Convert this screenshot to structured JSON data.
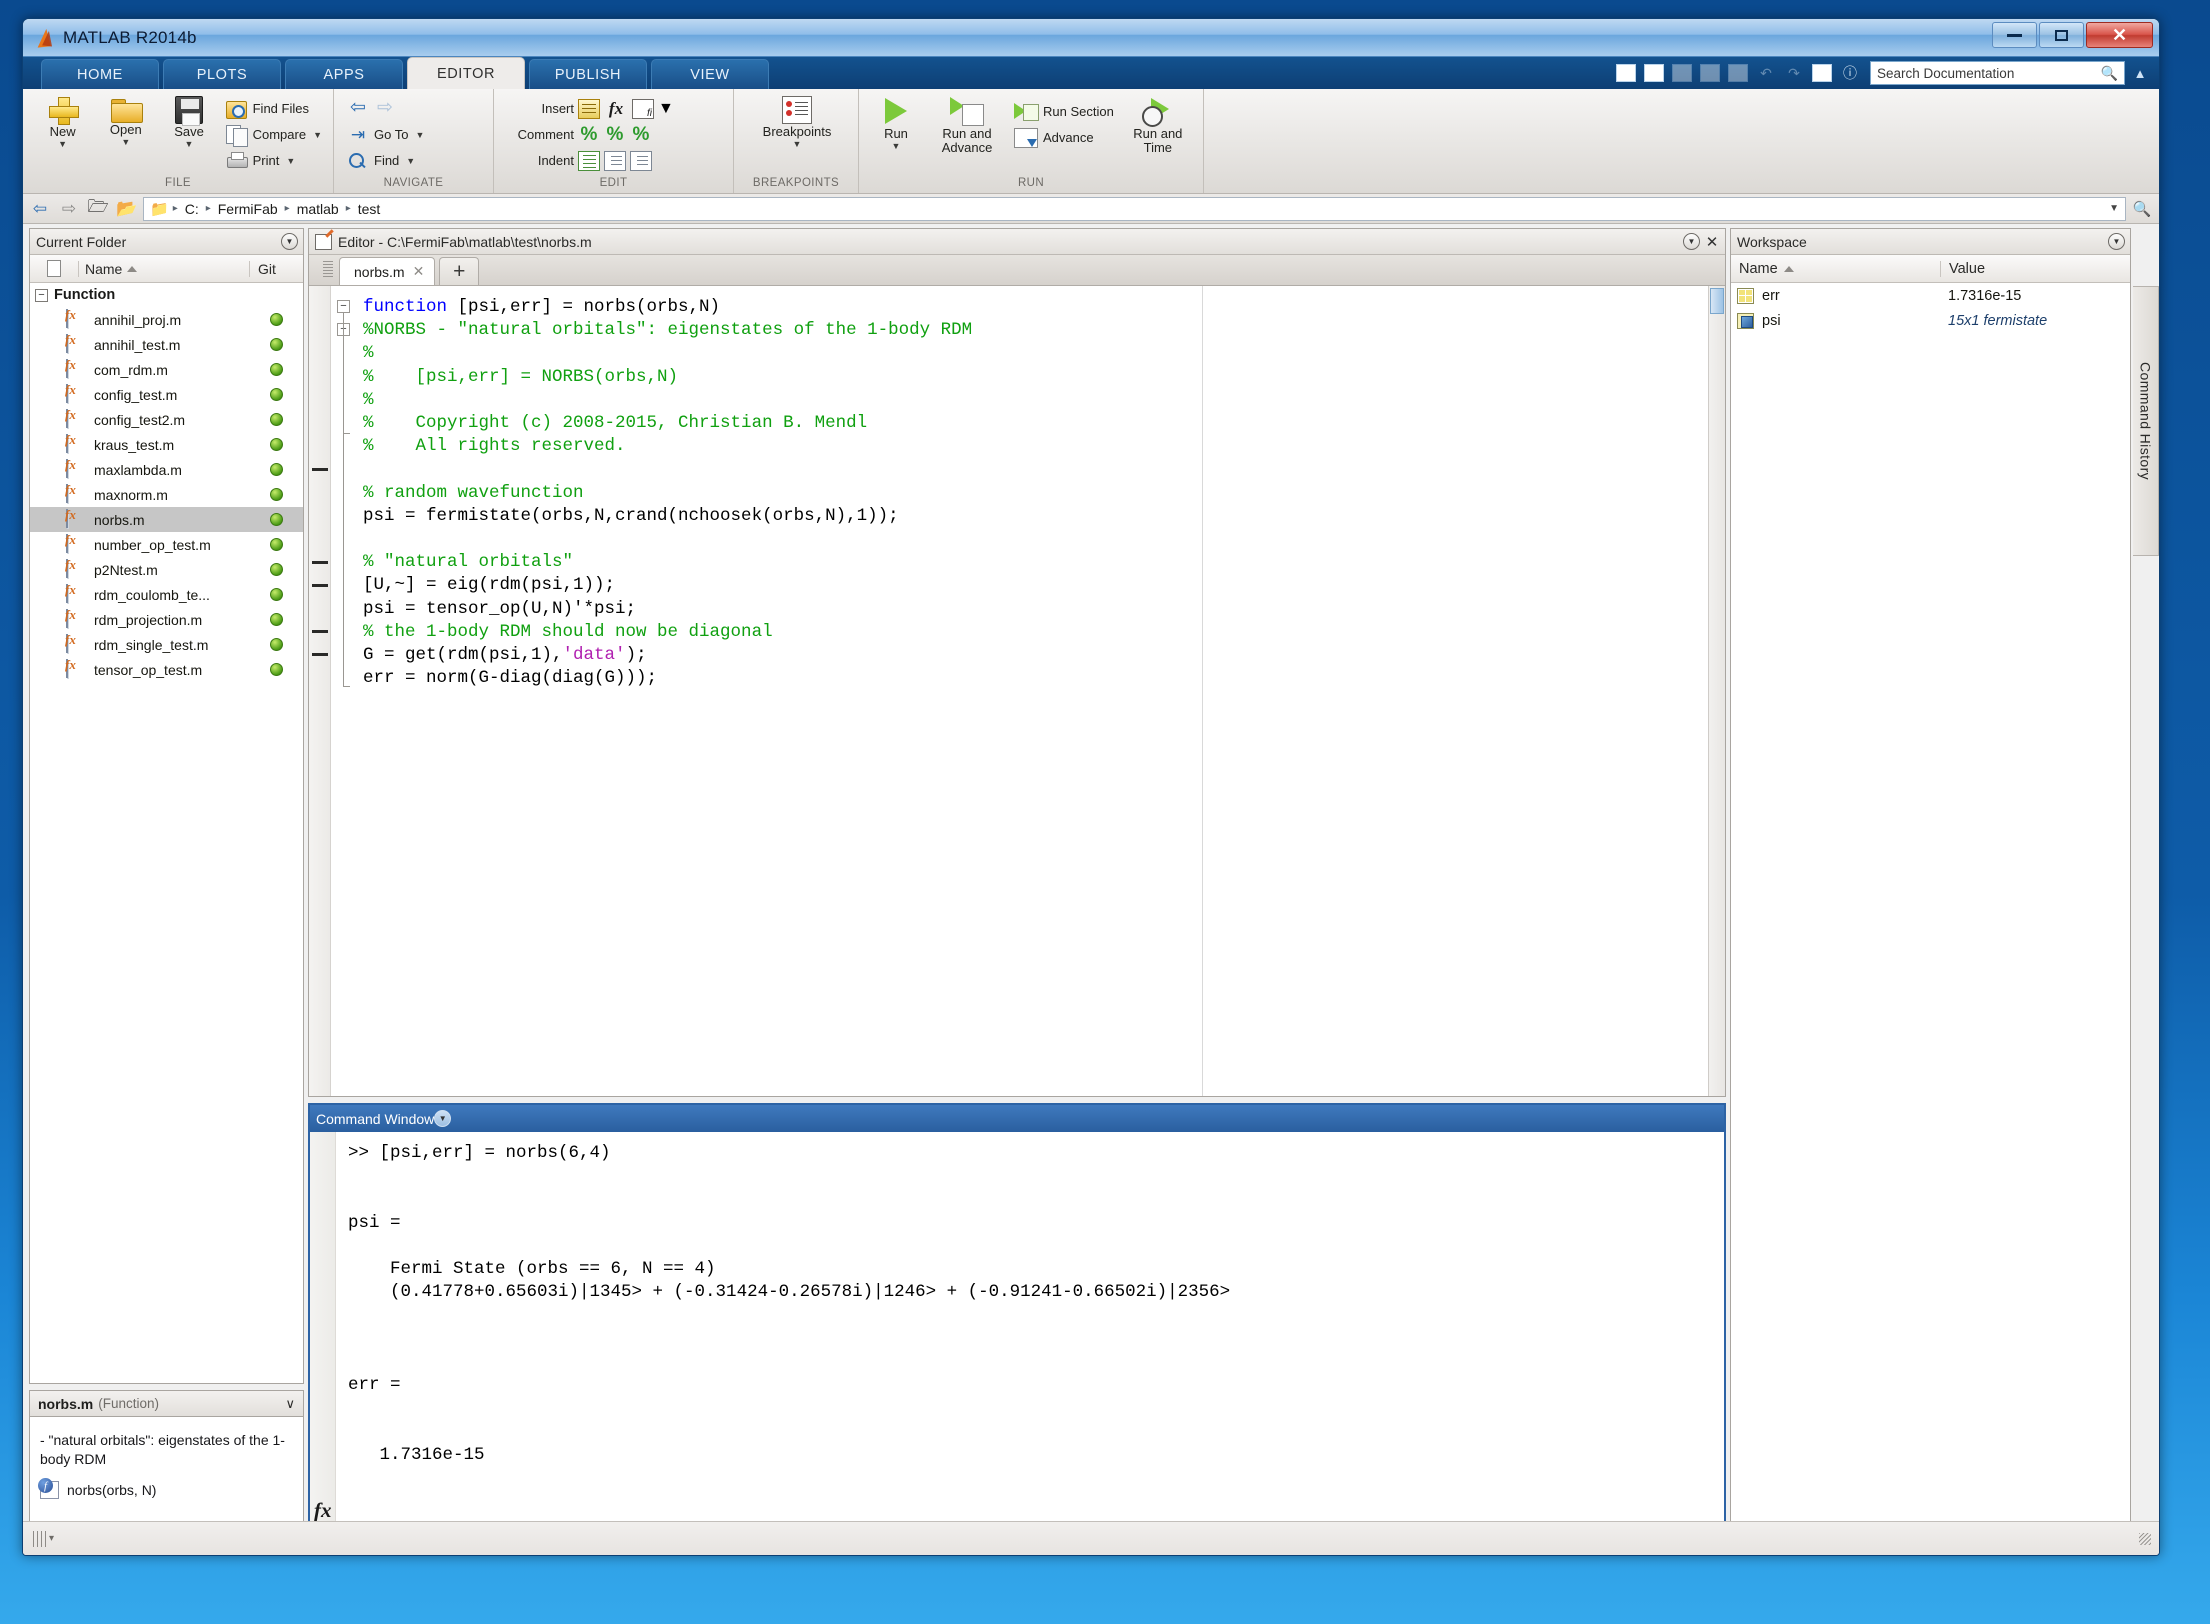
{
  "window": {
    "title": "MATLAB R2014b",
    "logo_icon": "matlab-logo-icon",
    "minimize_label": "",
    "maximize_label": "",
    "close_label": "✕"
  },
  "ribbon": {
    "tabs": [
      {
        "label": "HOME",
        "active": false
      },
      {
        "label": "PLOTS",
        "active": false
      },
      {
        "label": "APPS",
        "active": false
      },
      {
        "label": "EDITOR",
        "active": true
      },
      {
        "label": "PUBLISH",
        "active": false
      },
      {
        "label": "VIEW",
        "active": false
      }
    ],
    "quick_tools": [
      {
        "name": "new-script-icon",
        "glyph": "↗",
        "dim": false
      },
      {
        "name": "save-icon",
        "glyph": "▣",
        "dim": false
      },
      {
        "name": "cut-icon",
        "glyph": "✂",
        "dim": true
      },
      {
        "name": "copy-icon",
        "glyph": "⧉",
        "dim": true
      },
      {
        "name": "paste-icon",
        "glyph": "Ὄb",
        "dim": true
      },
      {
        "name": "undo-icon",
        "glyph": "↶",
        "dim": true
      },
      {
        "name": "redo-icon",
        "glyph": "↷",
        "dim": true
      },
      {
        "name": "layout-icon",
        "glyph": "❐",
        "dim": false
      },
      {
        "name": "help-icon",
        "glyph": "?",
        "dim": false
      }
    ],
    "search": {
      "placeholder": "Search Documentation",
      "value": "",
      "icon": "search-icon"
    },
    "collapse_icon": "▲",
    "groups": [
      {
        "label": "FILE",
        "big_buttons": [
          {
            "label": "New",
            "icon": "new-file-icon",
            "caret": "▼"
          },
          {
            "label": "Open",
            "icon": "open-folder-icon",
            "caret": "▼"
          },
          {
            "label": "Save",
            "icon": "save-disk-icon",
            "caret": "▼"
          }
        ],
        "small_buttons": [
          {
            "label": "Find Files",
            "icon": "find-files-icon",
            "caret": ""
          },
          {
            "label": "Compare",
            "icon": "compare-icon",
            "caret": "▼"
          },
          {
            "label": "Print",
            "icon": "print-icon",
            "caret": "▼"
          }
        ]
      },
      {
        "label": "NAVIGATE",
        "small_buttons": [
          {
            "label": "",
            "icon": "back-forward-arrows-icon",
            "caret": ""
          },
          {
            "label": "Go To",
            "icon": "go-to-icon",
            "caret": "▼"
          },
          {
            "label": "Find",
            "icon": "find-icon",
            "caret": "▼"
          }
        ]
      },
      {
        "label": "EDIT",
        "rows": [
          {
            "label": "Insert",
            "icons": [
              "insert-block-icon",
              "insert-function-icon",
              "insert-figure-icon"
            ],
            "caret": "▼"
          },
          {
            "label": "Comment",
            "icons": [
              "comment-icon",
              "uncomment-icon",
              "wrap-comment-icon"
            ],
            "caret": ""
          },
          {
            "label": "Indent",
            "icons": [
              "smart-indent-icon",
              "increase-indent-icon",
              "decrease-indent-icon"
            ],
            "caret": ""
          }
        ]
      },
      {
        "label": "BREAKPOINTS",
        "big_buttons": [
          {
            "label": "Breakpoints",
            "icon": "breakpoints-icon",
            "caret": "▼"
          }
        ]
      },
      {
        "label": "RUN",
        "big_buttons": [
          {
            "label": "Run",
            "icon": "run-icon",
            "caret": "▼"
          },
          {
            "label": "Run and\nAdvance",
            "icon": "run-and-advance-icon",
            "caret": ""
          },
          {
            "label": "Run and\nTime",
            "icon": "run-and-time-icon",
            "caret": ""
          }
        ],
        "small_buttons": [
          {
            "label": "Run Section",
            "icon": "run-section-icon",
            "caret": ""
          },
          {
            "label": "Advance",
            "icon": "advance-icon",
            "caret": ""
          }
        ]
      }
    ]
  },
  "address_bar": {
    "back_icon": "back-arrow-icon",
    "forward_icon": "forward-arrow-icon",
    "up_icon": "up-folder-icon",
    "browse_icon": "browse-folder-icon",
    "folder_icon": "folder-icon",
    "crumbs": [
      "C:",
      "FermiFab",
      "matlab",
      "test"
    ],
    "separator": "▸",
    "dropdown_caret": "▼",
    "search_icon": "search-icon"
  },
  "current_folder": {
    "title": "Current Folder",
    "panel_menu_icon": "panel-menu-icon",
    "columns": {
      "icon": "",
      "name": "Name",
      "git": "Git"
    },
    "sort_caret": "▲",
    "group": {
      "label": "Function",
      "expander": "−"
    },
    "files": [
      {
        "name": "annihil_proj.m",
        "git": "green",
        "selected": false
      },
      {
        "name": "annihil_test.m",
        "git": "green",
        "selected": false
      },
      {
        "name": "com_rdm.m",
        "git": "green",
        "selected": false
      },
      {
        "name": "config_test.m",
        "git": "green",
        "selected": false
      },
      {
        "name": "config_test2.m",
        "git": "green",
        "selected": false
      },
      {
        "name": "kraus_test.m",
        "git": "green",
        "selected": false
      },
      {
        "name": "maxlambda.m",
        "git": "green",
        "selected": false
      },
      {
        "name": "maxnorm.m",
        "git": "green",
        "selected": false
      },
      {
        "name": "norbs.m",
        "git": "green",
        "selected": true
      },
      {
        "name": "number_op_test.m",
        "git": "green",
        "selected": false
      },
      {
        "name": "p2Ntest.m",
        "git": "green",
        "selected": false
      },
      {
        "name": "rdm_coulomb_te...",
        "git": "green",
        "selected": false
      },
      {
        "name": "rdm_projection.m",
        "git": "green",
        "selected": false
      },
      {
        "name": "rdm_single_test.m",
        "git": "green",
        "selected": false
      },
      {
        "name": "tensor_op_test.m",
        "git": "green",
        "selected": false
      }
    ]
  },
  "function_details": {
    "name": "norbs.m",
    "kind": "(Function)",
    "chevron": "∨",
    "description": "- \"natural orbitals\": eigenstates of the 1-body RDM",
    "signature": "norbs(orbs, N)",
    "signature_icon": "function-badge-icon"
  },
  "editor": {
    "title": "Editor - C:\\FermiFab\\matlab\\test\\norbs.m",
    "title_icon": "editor-pencil-icon",
    "panel_menu_icon": "panel-menu-icon",
    "close_icon": "✕",
    "tabs": [
      {
        "label": "norbs.m",
        "close": "✕",
        "active": true
      }
    ],
    "new_tab_label": "+",
    "code": "function [psi,err] = norbs(orbs,N)\n%NORBS - \"natural orbitals\": eigenstates of the 1-body RDM\n%\n%    [psi,err] = NORBS(orbs,N)\n%\n%    Copyright (c) 2008-2015, Christian B. Mendl\n%    All rights reserved.\n\n% random wavefunction\npsi = fermistate(orbs,N,crand(nchoosek(orbs,N),1));\n\n% \"natural orbitals\"\n[U,~] = eig(rdm(psi,1));\npsi = tensor_op(U,N)'*psi;\n% the 1-body RDM should now be diagonal\nG = get(rdm(psi,1),'data');\nerr = norm(G-diag(diag(G)));"
  },
  "command_window": {
    "title": "Command Window",
    "panel_menu_icon": "panel-menu-icon",
    "fx_icon": "fx-icon",
    "prompt": ">>",
    "output": ">> [psi,err] = norbs(6,4)\n\n\npsi =\n\n    Fermi State (orbs == 6, N == 4)\n    (0.41778+0.65603i)|1345> + (-0.31424-0.26578i)|1246> + (-0.91241-0.66502i)|2356>\n\n\n\nerr =\n\n\n   1.7316e-15\n\n"
  },
  "workspace": {
    "title": "Workspace",
    "panel_menu_icon": "panel-menu-icon",
    "columns": {
      "name": "Name",
      "value": "Value"
    },
    "sort_caret": "▲",
    "rows": [
      {
        "name": "err",
        "value": "1.7316e-15",
        "icon": "matrix-icon",
        "italic": false
      },
      {
        "name": "psi",
        "value": "15x1 fermistate",
        "icon": "object-icon",
        "italic": true
      }
    ],
    "scroll_left_icon": "◀",
    "scroll_right_icon": "▶",
    "thumb_grip": "‖"
  },
  "right_rail": {
    "command_history_label": "Command History"
  },
  "status_bar": {
    "grip_icon": "resize-grip-icon"
  },
  "colors": {
    "titlebar_blue": "#2a5f9f",
    "ribbon_gray": "#dcd9d5",
    "keyword_blue": "#0000ff",
    "comment_green": "#10a010",
    "string_magenta": "#b020b0",
    "git_green": "#4c9c16",
    "accent": "#2b6cb0"
  }
}
